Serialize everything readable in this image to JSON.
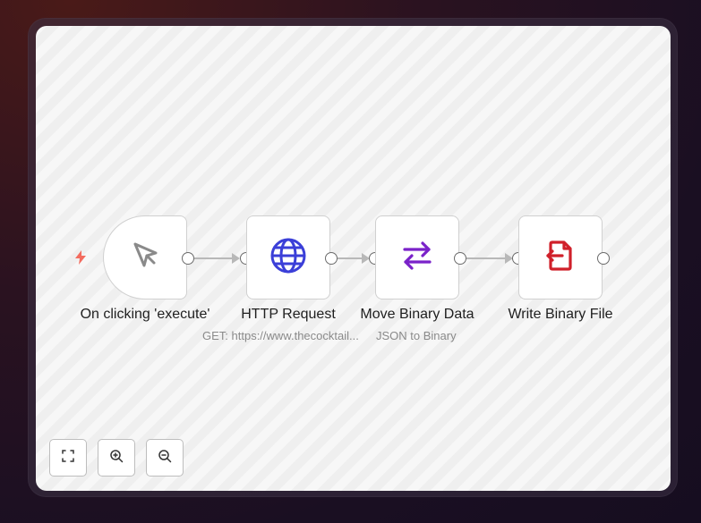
{
  "workflow": {
    "nodes": [
      {
        "label": "On clicking 'execute'",
        "icon": "cursor-icon",
        "color": "#8a8a8a"
      },
      {
        "label": "HTTP Request",
        "icon": "globe-icon",
        "color": "#3b3fd8"
      },
      {
        "label": "Move Binary Data",
        "icon": "arrows-exchange-icon",
        "color": "#7a22c9"
      },
      {
        "label": "Write Binary File",
        "icon": "file-export-icon",
        "color": "#d0202a"
      }
    ],
    "subtitles": {
      "http_request": "GET: https://www.thecocktail...",
      "move_binary": "JSON to Binary"
    },
    "trigger_badge_color": "#f36b5e"
  },
  "controls": {
    "fit": "zoom-to-fit-icon",
    "zoom_in": "zoom-in-icon",
    "zoom_out": "zoom-out-icon"
  }
}
